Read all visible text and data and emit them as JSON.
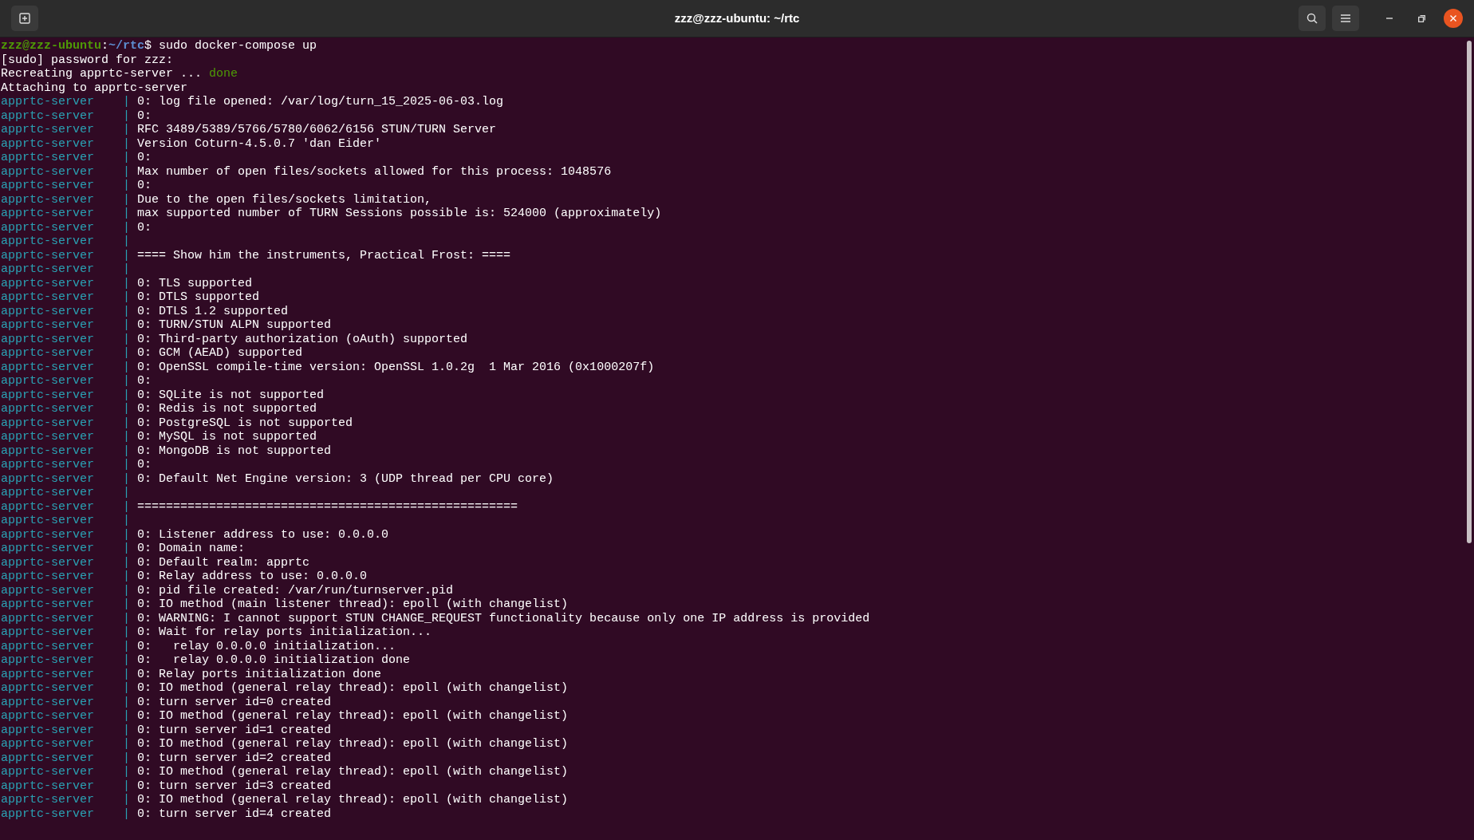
{
  "window": {
    "title": "zzz@zzz-ubuntu: ~/rtc"
  },
  "lines": [
    {
      "kind": "prompt",
      "user_host": "zzz@zzz-ubuntu",
      "separator": ":",
      "path": "~/rtc",
      "symbol": "$",
      "command": "sudo docker-compose up"
    },
    {
      "kind": "plain",
      "text": "[sudo] password for zzz:"
    },
    {
      "kind": "status",
      "text": "Recreating apprtc-server ...",
      "status": "done"
    },
    {
      "kind": "plain",
      "text": "Attaching to apprtc-server"
    },
    {
      "kind": "log",
      "prefix": "apprtc-server    |",
      "message": "0: log file opened: /var/log/turn_15_2025-06-03.log"
    },
    {
      "kind": "log",
      "prefix": "apprtc-server    |",
      "message": "0:"
    },
    {
      "kind": "log",
      "prefix": "apprtc-server    |",
      "message": "RFC 3489/5389/5766/5780/6062/6156 STUN/TURN Server"
    },
    {
      "kind": "log",
      "prefix": "apprtc-server    |",
      "message": "Version Coturn-4.5.0.7 'dan Eider'"
    },
    {
      "kind": "log",
      "prefix": "apprtc-server    |",
      "message": "0:"
    },
    {
      "kind": "log",
      "prefix": "apprtc-server    |",
      "message": "Max number of open files/sockets allowed for this process: 1048576"
    },
    {
      "kind": "log",
      "prefix": "apprtc-server    |",
      "message": "0:"
    },
    {
      "kind": "log",
      "prefix": "apprtc-server    |",
      "message": "Due to the open files/sockets limitation,"
    },
    {
      "kind": "log",
      "prefix": "apprtc-server    |",
      "message": "max supported number of TURN Sessions possible is: 524000 (approximately)"
    },
    {
      "kind": "log",
      "prefix": "apprtc-server    |",
      "message": "0:"
    },
    {
      "kind": "log",
      "prefix": "apprtc-server    |"
    },
    {
      "kind": "log",
      "prefix": "apprtc-server    |",
      "message": "==== Show him the instruments, Practical Frost: ===="
    },
    {
      "kind": "log",
      "prefix": "apprtc-server    |"
    },
    {
      "kind": "log",
      "prefix": "apprtc-server    |",
      "message": "0: TLS supported"
    },
    {
      "kind": "log",
      "prefix": "apprtc-server    |",
      "message": "0: DTLS supported"
    },
    {
      "kind": "log",
      "prefix": "apprtc-server    |",
      "message": "0: DTLS 1.2 supported"
    },
    {
      "kind": "log",
      "prefix": "apprtc-server    |",
      "message": "0: TURN/STUN ALPN supported"
    },
    {
      "kind": "log",
      "prefix": "apprtc-server    |",
      "message": "0: Third-party authorization (oAuth) supported"
    },
    {
      "kind": "log",
      "prefix": "apprtc-server    |",
      "message": "0: GCM (AEAD) supported"
    },
    {
      "kind": "log",
      "prefix": "apprtc-server    |",
      "message": "0: OpenSSL compile-time version: OpenSSL 1.0.2g  1 Mar 2016 (0x1000207f)"
    },
    {
      "kind": "log",
      "prefix": "apprtc-server    |",
      "message": "0:"
    },
    {
      "kind": "log",
      "prefix": "apprtc-server    |",
      "message": "0: SQLite is not supported"
    },
    {
      "kind": "log",
      "prefix": "apprtc-server    |",
      "message": "0: Redis is not supported"
    },
    {
      "kind": "log",
      "prefix": "apprtc-server    |",
      "message": "0: PostgreSQL is not supported"
    },
    {
      "kind": "log",
      "prefix": "apprtc-server    |",
      "message": "0: MySQL is not supported"
    },
    {
      "kind": "log",
      "prefix": "apprtc-server    |",
      "message": "0: MongoDB is not supported"
    },
    {
      "kind": "log",
      "prefix": "apprtc-server    |",
      "message": "0:"
    },
    {
      "kind": "log",
      "prefix": "apprtc-server    |",
      "message": "0: Default Net Engine version: 3 (UDP thread per CPU core)"
    },
    {
      "kind": "log",
      "prefix": "apprtc-server    |"
    },
    {
      "kind": "log",
      "prefix": "apprtc-server    |",
      "message": "====================================================="
    },
    {
      "kind": "log",
      "prefix": "apprtc-server    |"
    },
    {
      "kind": "log",
      "prefix": "apprtc-server    |",
      "message": "0: Listener address to use: 0.0.0.0"
    },
    {
      "kind": "log",
      "prefix": "apprtc-server    |",
      "message": "0: Domain name:"
    },
    {
      "kind": "log",
      "prefix": "apprtc-server    |",
      "message": "0: Default realm: apprtc"
    },
    {
      "kind": "log",
      "prefix": "apprtc-server    |",
      "message": "0: Relay address to use: 0.0.0.0"
    },
    {
      "kind": "log",
      "prefix": "apprtc-server    |",
      "message": "0: pid file created: /var/run/turnserver.pid"
    },
    {
      "kind": "log",
      "prefix": "apprtc-server    |",
      "message": "0: IO method (main listener thread): epoll (with changelist)"
    },
    {
      "kind": "log",
      "prefix": "apprtc-server    |",
      "message": "0: WARNING: I cannot support STUN CHANGE_REQUEST functionality because only one IP address is provided"
    },
    {
      "kind": "log",
      "prefix": "apprtc-server    |",
      "message": "0: Wait for relay ports initialization..."
    },
    {
      "kind": "log",
      "prefix": "apprtc-server    |",
      "message": "0:   relay 0.0.0.0 initialization..."
    },
    {
      "kind": "log",
      "prefix": "apprtc-server    |",
      "message": "0:   relay 0.0.0.0 initialization done"
    },
    {
      "kind": "log",
      "prefix": "apprtc-server    |",
      "message": "0: Relay ports initialization done"
    },
    {
      "kind": "log",
      "prefix": "apprtc-server    |",
      "message": "0: IO method (general relay thread): epoll (with changelist)"
    },
    {
      "kind": "log",
      "prefix": "apprtc-server    |",
      "message": "0: turn server id=0 created"
    },
    {
      "kind": "log",
      "prefix": "apprtc-server    |",
      "message": "0: IO method (general relay thread): epoll (with changelist)"
    },
    {
      "kind": "log",
      "prefix": "apprtc-server    |",
      "message": "0: turn server id=1 created"
    },
    {
      "kind": "log",
      "prefix": "apprtc-server    |",
      "message": "0: IO method (general relay thread): epoll (with changelist)"
    },
    {
      "kind": "log",
      "prefix": "apprtc-server    |",
      "message": "0: turn server id=2 created"
    },
    {
      "kind": "log",
      "prefix": "apprtc-server    |",
      "message": "0: IO method (general relay thread): epoll (with changelist)"
    },
    {
      "kind": "log",
      "prefix": "apprtc-server    |",
      "message": "0: turn server id=3 created"
    },
    {
      "kind": "log",
      "prefix": "apprtc-server    |",
      "message": "0: IO method (general relay thread): epoll (with changelist)"
    },
    {
      "kind": "log",
      "prefix": "apprtc-server    |",
      "message": "0: turn server id=4 created"
    }
  ]
}
